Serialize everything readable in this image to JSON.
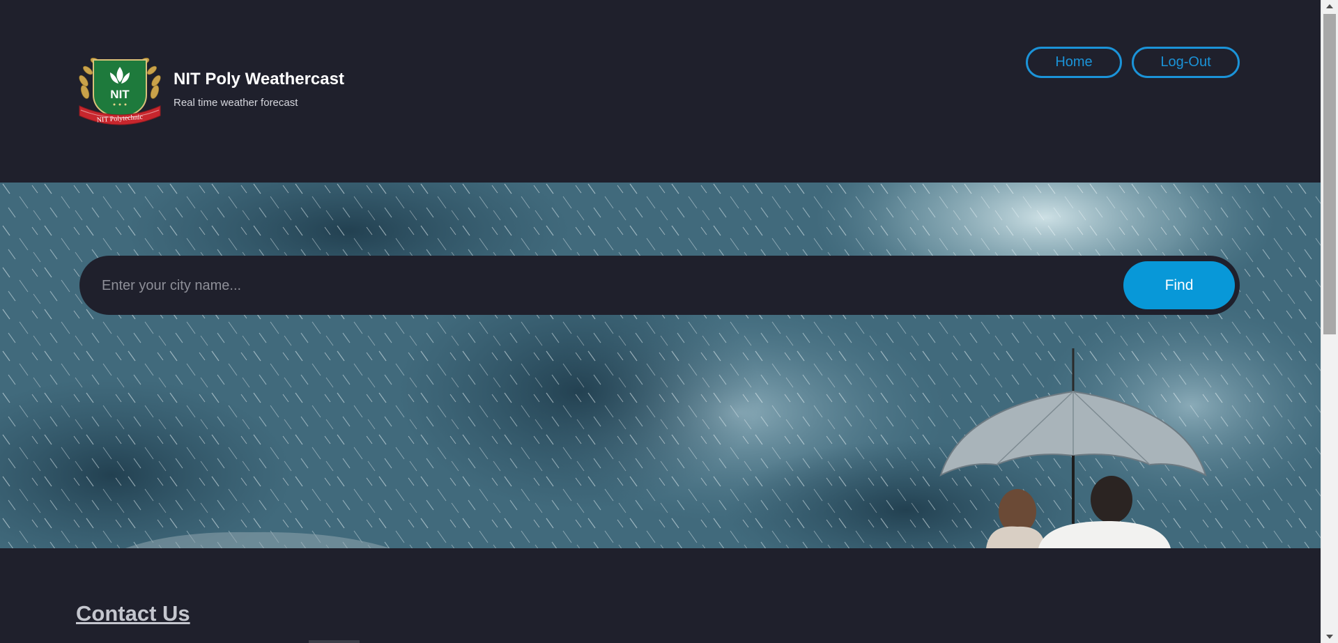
{
  "header": {
    "title": "NIT Poly Weathercast",
    "subtitle": "Real time weather forecast",
    "logo_text": "NIT",
    "logo_ribbon_text": "NIT Polytechnic"
  },
  "nav": {
    "home_label": "Home",
    "logout_label": "Log-Out"
  },
  "search": {
    "placeholder": "Enter your city name...",
    "value": "",
    "button_label": "Find"
  },
  "footer": {
    "contact_title": "Contact Us"
  },
  "colors": {
    "background": "#1f202c",
    "accent": "#0898d8",
    "nav_border": "#1b93d8"
  }
}
